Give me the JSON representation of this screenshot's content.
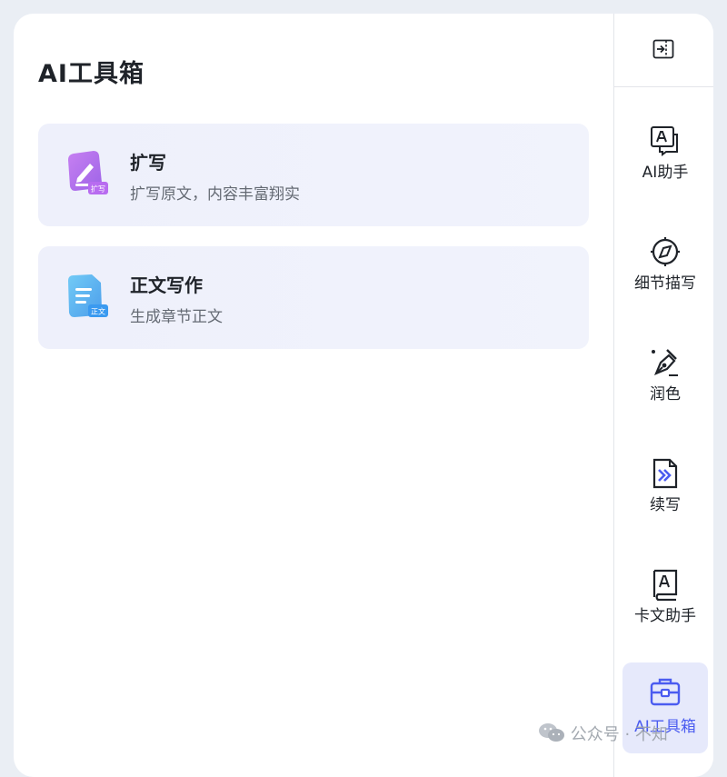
{
  "panel": {
    "title": "AI工具箱"
  },
  "cards": [
    {
      "title": "扩写",
      "desc": "扩写原文，内容丰富翔实",
      "icon": "expand-write-icon",
      "badge": "扩写"
    },
    {
      "title": "正文写作",
      "desc": "生成章节正文",
      "icon": "document-write-icon",
      "badge": "正文"
    }
  ],
  "sidebar": {
    "collapse_icon": "collapse-panel-icon",
    "tools": [
      {
        "label": "AI助手",
        "icon": "ai-assistant-icon",
        "active": false
      },
      {
        "label": "细节描写",
        "icon": "compass-icon",
        "active": false
      },
      {
        "label": "润色",
        "icon": "pen-nib-icon",
        "active": false
      },
      {
        "label": "续写",
        "icon": "continue-write-icon",
        "active": false
      },
      {
        "label": "卡文助手",
        "icon": "book-icon",
        "active": false
      },
      {
        "label": "AI工具箱",
        "icon": "toolbox-icon",
        "active": true
      }
    ]
  },
  "watermark": {
    "text": "公众号 · 不知"
  },
  "colors": {
    "accent": "#4b5cf0",
    "card_bg": "#eef0fb",
    "page_bg": "#eaeef4",
    "active_bg": "#e6e9fb"
  }
}
